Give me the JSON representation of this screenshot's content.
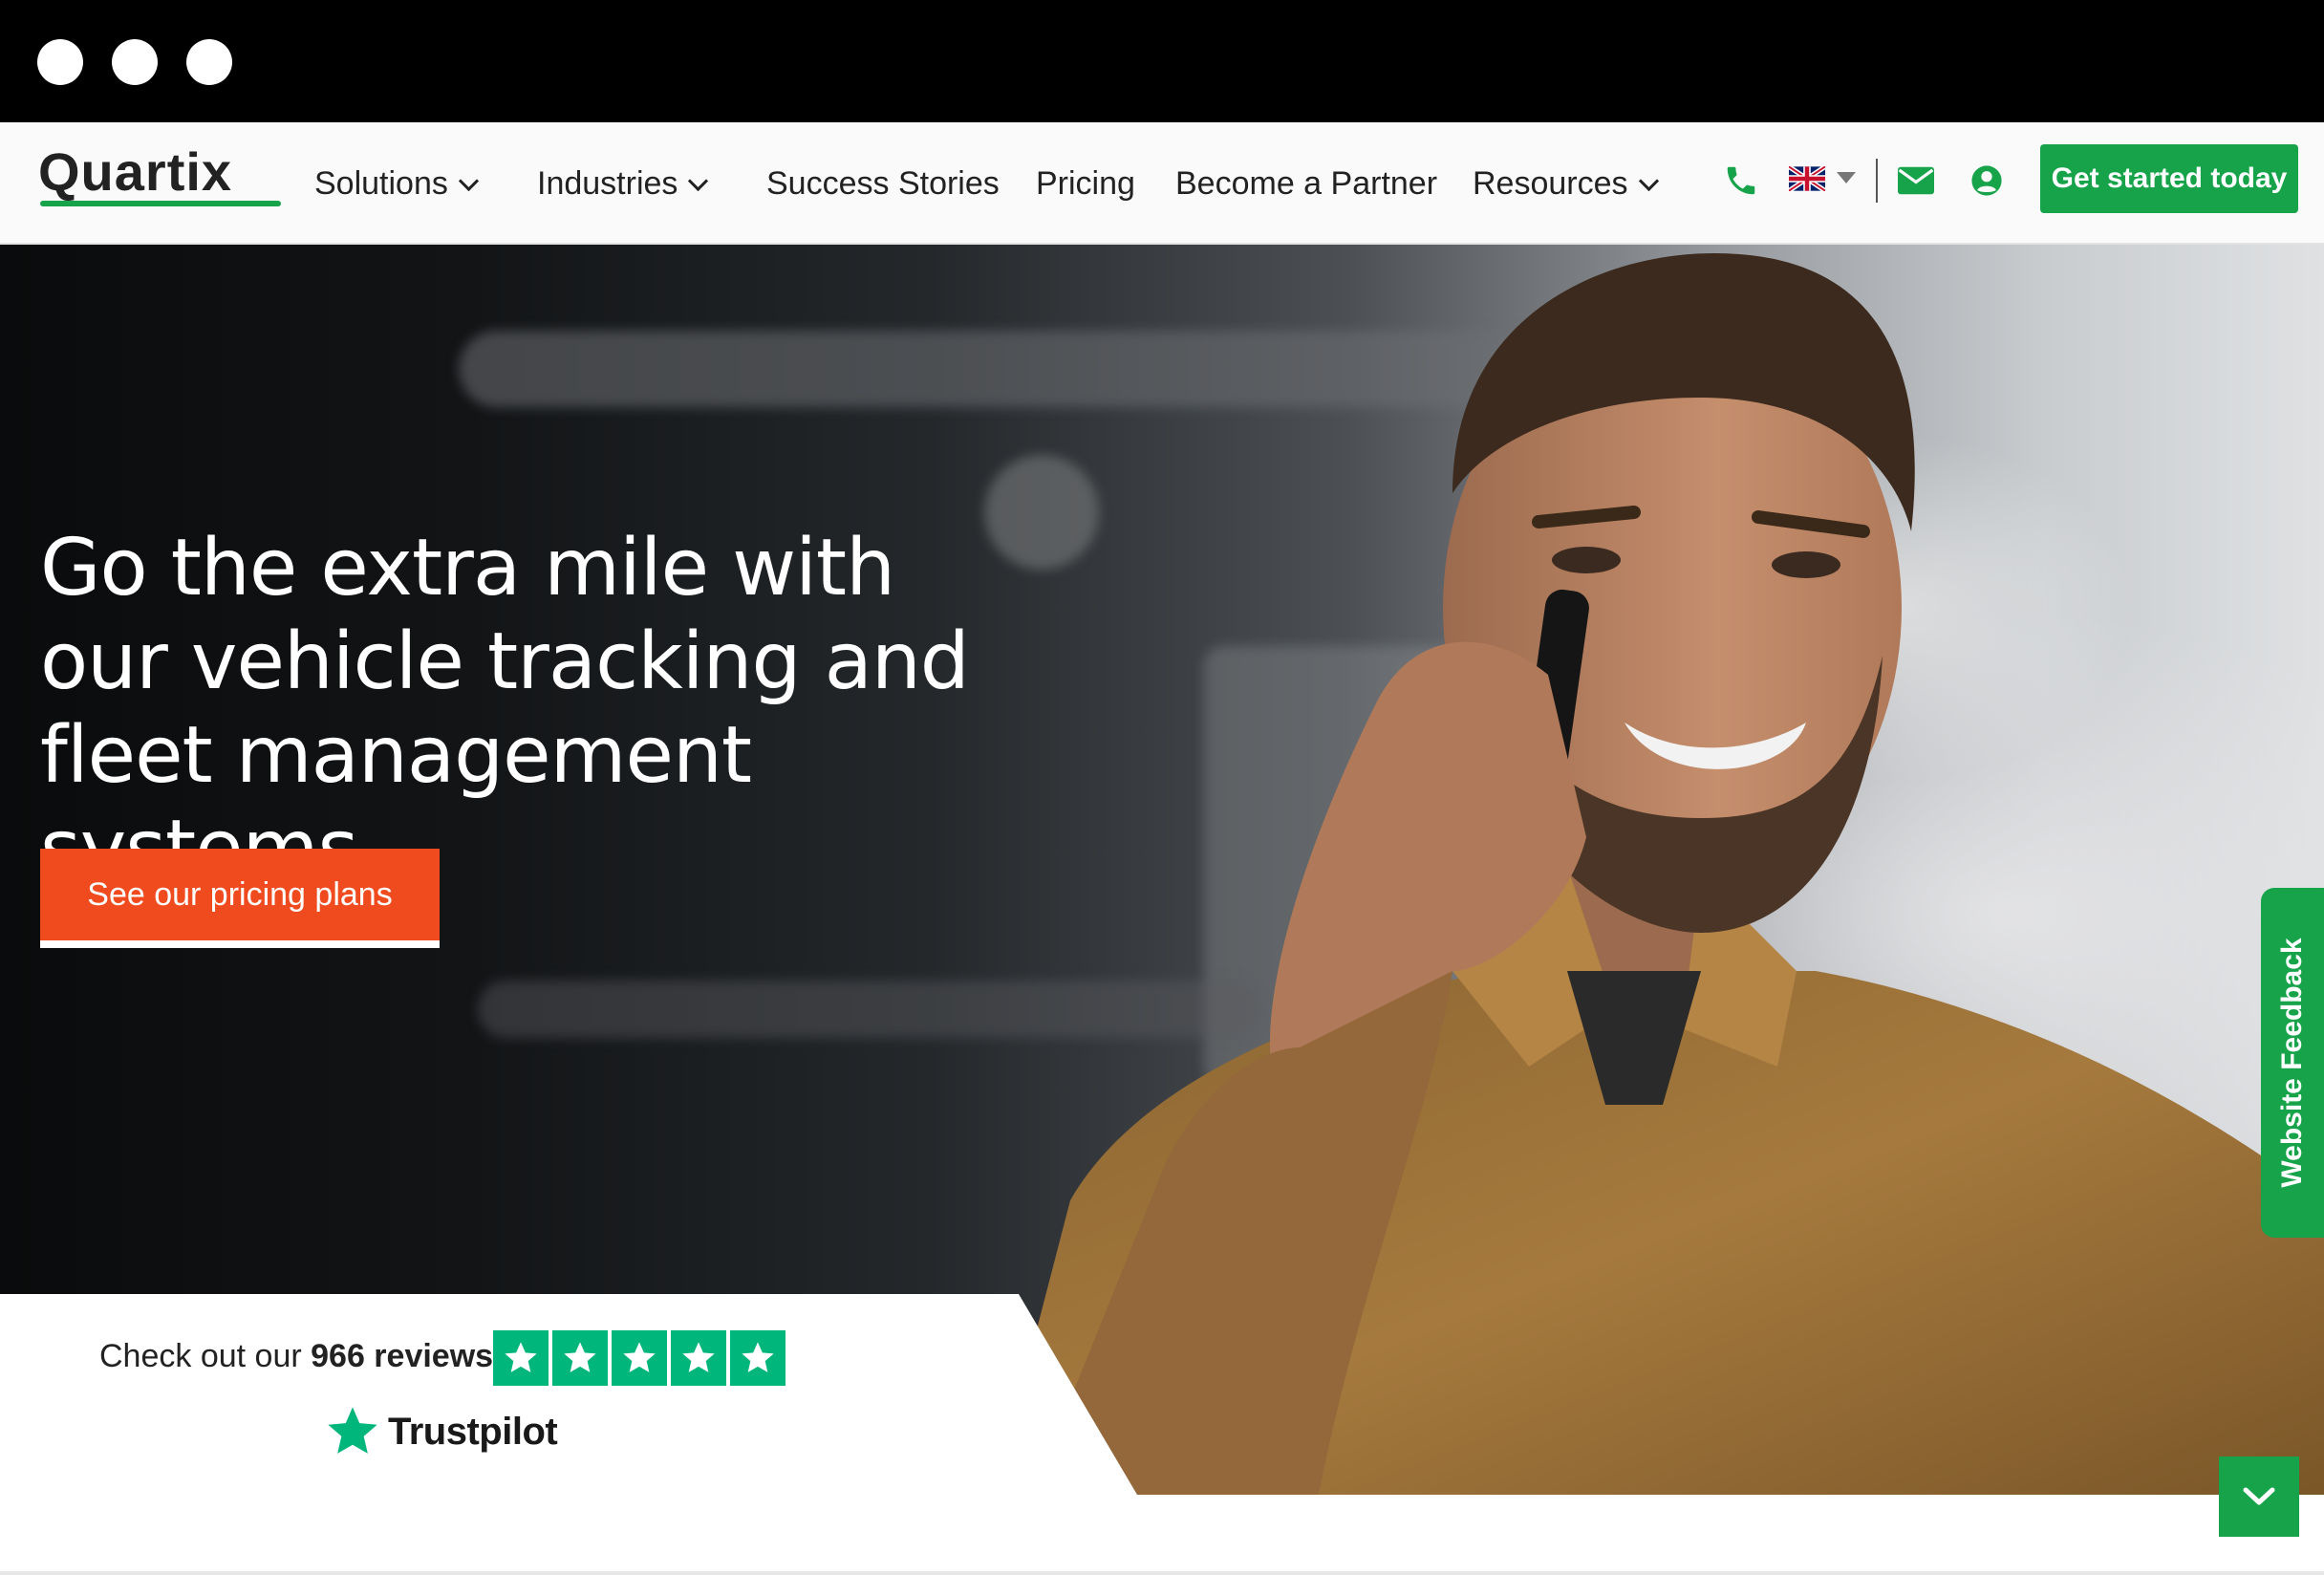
{
  "window": {
    "controls": [
      "dot",
      "dot",
      "dot"
    ]
  },
  "nav": {
    "logo": "Quartix",
    "items": [
      {
        "label": "Solutions",
        "has_dropdown": true
      },
      {
        "label": "Industries",
        "has_dropdown": true
      },
      {
        "label": "Success Stories",
        "has_dropdown": false
      },
      {
        "label": "Pricing",
        "has_dropdown": false
      },
      {
        "label": "Become a Partner",
        "has_dropdown": false
      },
      {
        "label": "Resources",
        "has_dropdown": true
      }
    ],
    "icons": [
      "phone-icon",
      "uk-flag-icon",
      "caret-down-icon",
      "mail-icon",
      "user-icon"
    ],
    "cta": "Get started today"
  },
  "hero": {
    "title": "Go the extra mile with our vehicle tracking and fleet management systems.",
    "button": "See our pricing plans"
  },
  "feedback": {
    "label": "Website Feedback"
  },
  "trustpilot": {
    "prefix": "Check out our",
    "count": "966 reviews",
    "stars": 5,
    "brand": "Trustpilot"
  },
  "colors": {
    "brand_green": "#16a34a",
    "cta_orange": "#ef4b1f",
    "trustpilot_green": "#00b67a"
  }
}
